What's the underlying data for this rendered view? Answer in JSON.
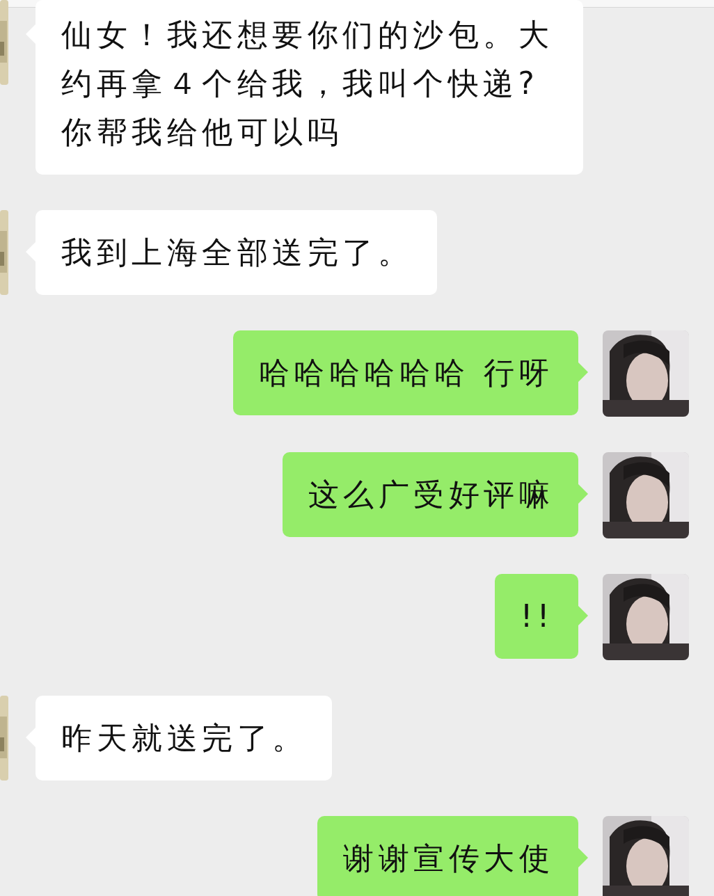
{
  "messages": [
    {
      "kind": "incoming",
      "text": "仙女！我还想要你们的沙包。大约再拿４个给我，我叫个快递?你帮我给他可以吗"
    },
    {
      "kind": "incoming",
      "text": "我到上海全部送完了。"
    },
    {
      "kind": "outgoing",
      "text": "哈哈哈哈哈哈 行呀"
    },
    {
      "kind": "outgoing",
      "text": "这么广受好评嘛"
    },
    {
      "kind": "outgoing",
      "text": "!!"
    },
    {
      "kind": "incoming",
      "text": "昨天就送完了。"
    },
    {
      "kind": "outgoing",
      "text": "谢谢宣传大使"
    }
  ]
}
